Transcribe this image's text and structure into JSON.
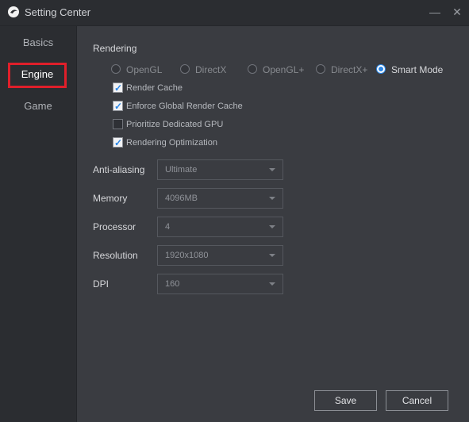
{
  "window": {
    "title": "Setting Center",
    "logo_icon": "app-logo-icon",
    "minimize_glyph": "—",
    "close_glyph": "✕"
  },
  "sidebar": {
    "items": [
      {
        "label": "Basics"
      },
      {
        "label": "Engine",
        "selected": true,
        "highlight_color": "#e01f2a"
      },
      {
        "label": "Game"
      }
    ]
  },
  "rendering": {
    "title": "Rendering",
    "modes": [
      {
        "label": "OpenGL",
        "checked": false
      },
      {
        "label": "DirectX",
        "checked": false
      },
      {
        "label": "OpenGL+",
        "checked": false
      },
      {
        "label": "DirectX+",
        "checked": false
      },
      {
        "label": "Smart Mode",
        "checked": true
      }
    ],
    "options": [
      {
        "label": "Render Cache",
        "checked": true
      },
      {
        "label": "Enforce Global Render Cache",
        "checked": true
      },
      {
        "label": "Prioritize Dedicated GPU",
        "checked": false
      },
      {
        "label": "Rendering Optimization",
        "checked": true
      }
    ]
  },
  "fields": [
    {
      "label": "Anti-aliasing",
      "value": "Ultimate"
    },
    {
      "label": "Memory",
      "value": "4096MB"
    },
    {
      "label": "Processor",
      "value": "4"
    },
    {
      "label": "Resolution",
      "value": "1920x1080"
    },
    {
      "label": "DPI",
      "value": "160"
    }
  ],
  "buttons": {
    "save_label": "Save",
    "cancel_label": "Cancel"
  },
  "colors": {
    "accent": "#2a86e6",
    "background": "#3a3c41",
    "sidebar": "#2b2d31"
  }
}
